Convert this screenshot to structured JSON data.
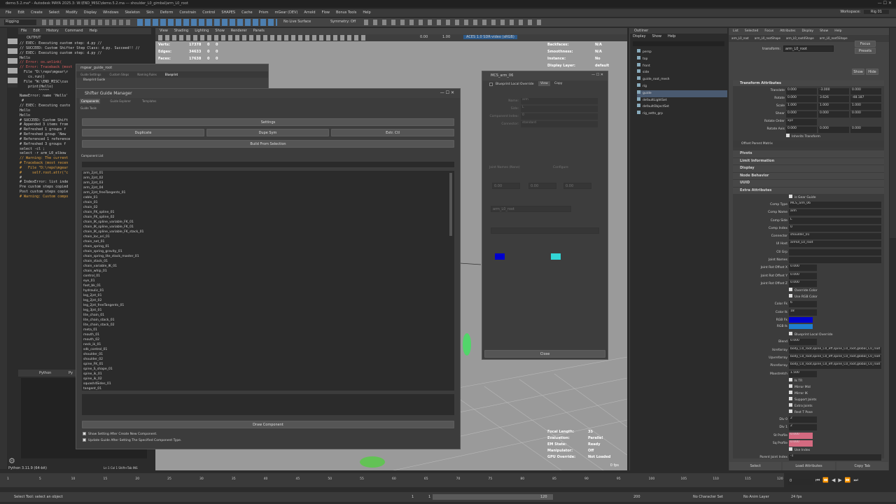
{
  "title_bar": {
    "text": "demo.5.2.ma* - Autodesk MAYA 2025.3: W:\\END_MISC\\demo.5.2.ma --- shoulder_L0_gimbal|arm_L0_root"
  },
  "menubar": {
    "items": [
      "File",
      "Edit",
      "Create",
      "Select",
      "Modify",
      "Display",
      "Windows",
      "Skeleton",
      "Skin",
      "Deform",
      "Constrain",
      "Control",
      "SHAPES",
      "Cache",
      "Prism",
      "mGear (DEV)",
      "Arnold",
      "Flow",
      "Bonus Tools",
      "Help"
    ],
    "workspace_label": "Workspace:",
    "workspace_value": "Rig 01"
  },
  "status_line": {
    "mode": "Rigging",
    "no_live": "No Live Surface",
    "symmetry": "Symmetry: Off"
  },
  "script_editor": {
    "menu": [
      "File",
      "Edit",
      "History",
      "Command",
      "Help"
    ],
    "output_label": "OUTPUT",
    "lines": [
      "// EXEC: Executing custom step: d.py //",
      "// SUCCEED: Custom Shifter Step Class: d.py. Succeed!! //",
      "// EXEC: Executing custom step: d.py //",
      "Hello",
      "// Error: os.unlink(",
      "// Error: Traceback (most",
      "  File \"D:\\repo\\mgear\\r",
      "    cs.run()",
      "  File \"W:\\END_MISC\\cus",
      "    print(Hello)",
      "         ^^^^^",
      "NameError: name 'Hello'",
      " #",
      "// EXEC: Executing custo",
      "Hello",
      "Hello",
      "# SUCCEED: Custom Shift",
      "# Appended 3 items from",
      "# Refreshed 1 groups f",
      "# Refreshed group 'New",
      "# Referenced 1 reference",
      "# Refreshed 3 groups f",
      "select -cl ;",
      "select -r arm_L0_elbow",
      "// Warning: The current",
      "# Traceback (most recen",
      "#   File \"D:\\repo\\mgear",
      "#     self.root.attr(\"c",
      "#",
      "# IndexError: list inde",
      "Pre custom steps copied",
      "Post custom steps copie",
      "# Warning: Custom compo"
    ],
    "tab_python": "Python",
    "tab_py2": "Py",
    "footer": "Python 3.11.9 (64-bit)",
    "line_col": "Ln 1  Col 1  Shift+Tab  INS"
  },
  "viewport": {
    "menu": [
      "View",
      "Shading",
      "Lighting",
      "Show",
      "Renderer",
      "Panels"
    ],
    "hud_left": [
      [
        "Verts:",
        "17378",
        "0",
        "0"
      ],
      [
        "Edges:",
        "34633",
        "0",
        "0"
      ],
      [
        "Faces:",
        "17638",
        "0",
        "0"
      ]
    ],
    "hud_right": [
      [
        "Backfaces:",
        "N/A"
      ],
      [
        "Smoothness:",
        "N/A"
      ],
      [
        "Instance:",
        "No"
      ],
      [
        "Display Layer:",
        "default"
      ]
    ],
    "hud_bottom": [
      [
        "Focal Length:",
        "35"
      ],
      [
        "Evaluation:",
        "Parallel"
      ],
      [
        "EM State:",
        "Ready"
      ],
      [
        "Manipulator:",
        "Off"
      ],
      [
        "GPU Override:",
        "Not Loaded"
      ]
    ],
    "fps": "0 fps",
    "colorspace": "ACES 1.0 SDR-video (sRGB)",
    "val1": "0.00",
    "val2": "1.00"
  },
  "mgear_root": {
    "title": "mgear_guide_root",
    "tabs": [
      "Guide Settings",
      "Custom Steps",
      "Naming Rules",
      "Blueprint"
    ],
    "sub": "Blueprint Guide"
  },
  "shifter": {
    "title": "Shifter Guide Manager",
    "tabs": [
      "Components",
      "Guide Explorer",
      "Templates"
    ],
    "guide_tools": "Guide Tools",
    "settings": "Settings",
    "duplicate": "Duplicate",
    "dupe_sym": "Dupe Sym",
    "extr_ctl": "Extr. Ctl",
    "build": "Build From Selection",
    "component_list": "Component List",
    "components": [
      "arm_2jnt_01",
      "arm_2jnt_02",
      "arm_2jnt_03",
      "arm_2jnt_04",
      "arm_2jnt_freeTangents_01",
      "cable_01",
      "chain_01",
      "chain_02",
      "chain_FK_spline_01",
      "chain_FK_spline_02",
      "chain_IK_spline_variable_FK_01",
      "chain_IK_spline_variable_FK_01",
      "chain_IK_spline_variable_FK_stack_01",
      "chain_loc_ori_01",
      "chain_net_01",
      "chain_spring_01",
      "chain_spring_gravity_01",
      "chain_spring_lite_stack_master_01",
      "chain_stack_01",
      "chain_variable_IK_01",
      "chain_whip_01",
      "control_01",
      "eye_01",
      "foot_bk_01",
      "hydraulic_01",
      "leg_2jnt_01",
      "leg_2jnt_02",
      "leg_2jnt_freeTangents_01",
      "leg_3jnt_01",
      "lite_chain_01",
      "lite_chain_stack_01",
      "lite_chain_stack_02",
      "meta_01",
      "mouth_01",
      "mouth_02",
      "neck_ik_01",
      "sdk_control_01",
      "shoulder_01",
      "shoulder_02",
      "spine_FK_01",
      "spine_S_shape_01",
      "spine_ik_01",
      "spine_ik_02",
      "squash4Sides_01",
      "tangent_01"
    ],
    "draw": "Draw Component",
    "opt1": "Show Setting After Create New Component.",
    "opt2": "Update Guide After Setting The Specified Component Type."
  },
  "mcs_window": {
    "title": "MCS_arm_06",
    "tabs": [
      "View",
      "Copy"
    ],
    "header": "Blueprint Local Override",
    "close": "Close",
    "fields": [
      [
        "Name:",
        "arm"
      ],
      [
        "Side:",
        "L"
      ],
      [
        "Component Index:",
        "0"
      ],
      [
        "Connector:",
        "standard"
      ]
    ],
    "ui_host": "arm_L0_root",
    "configure": "Configure",
    "joint_names": "Joint Names (None)",
    "vals": [
      "0.00",
      "0.00",
      "0.00"
    ],
    "rgb_fk": "#0000cc",
    "rgb_ik": "#33d6d6"
  },
  "outliner": {
    "title": "Outliner",
    "menu": [
      "Display",
      "Show",
      "Help"
    ],
    "items": [
      "persp",
      "top",
      "front",
      "side",
      "guide_root_mesh",
      "rig",
      "guide",
      "defaultLightSet",
      "defaultObjectSet",
      "rig_setts_grp"
    ]
  },
  "attr_editor": {
    "menu": [
      "List",
      "Selected",
      "Focus",
      "Attributes",
      "Display",
      "Show",
      "Help"
    ],
    "tabs": [
      "arm_L0_root",
      "arm_L0_rootShape",
      "arm_L0_root4Shape",
      "arm_L0_root5Shape"
    ],
    "transform_label": "transform:",
    "transform_value": "arm_L0_root",
    "focus": "Focus",
    "presets": "Presets",
    "show": "Show",
    "hide": "Hide",
    "section_transform": "Transform Attributes",
    "translate": [
      "Translate",
      "0.000",
      "-3.000",
      "0.000"
    ],
    "rotate": [
      "Rotate",
      "0.000",
      "3.626",
      "-48.187"
    ],
    "scale": [
      "Scale",
      "1.000",
      "1.000",
      "1.000"
    ],
    "shear": [
      "Shear",
      "0.000",
      "0.000",
      "0.000"
    ],
    "rotate_order": [
      "Rotate Order",
      "xyz"
    ],
    "rotate_axis": [
      "Rotate Axis",
      "0.000",
      "0.000",
      "0.000"
    ],
    "inherits": "Inherits Transform",
    "offset_parent": "Offset Parent Matrix",
    "sections": [
      "Pivots",
      "Limit Information",
      "Display",
      "Node Behavior",
      "UUID",
      "Extra Attributes"
    ],
    "extra": [
      [
        "",
        "is Gear Guide"
      ],
      [
        "Comp Type",
        "MCS_arm_06"
      ],
      [
        "Comp Name",
        "arm"
      ],
      [
        "Comp Side",
        "L"
      ],
      [
        "Comp Index",
        "0"
      ],
      [
        "Connector",
        "shoulder_01"
      ],
      [
        "UI Host",
        "armUI_L0_root"
      ],
      [
        "Ctl Grp",
        ""
      ],
      [
        "Joint Names",
        ""
      ],
      [
        "Joint Rot Offset X",
        "0.000"
      ],
      [
        "Joint Rot Offset Y",
        "0.000"
      ],
      [
        "Joint Rot Offset Z",
        "0.000"
      ]
    ],
    "override_color": "Override Color",
    "use_rgb": "Use RGB Color",
    "color_fk": [
      "Color Fk",
      "6"
    ],
    "color_ik": [
      "Color Ik",
      "18"
    ],
    "rgb_fk": "RGB Fk",
    "rgb_ik": "RGB Ik",
    "bp_override": "Blueprint Local Override",
    "blend": [
      "Blend",
      "0.000"
    ],
    "arrays": [
      [
        "Ikrefarray",
        "body_C0_root,spine_C0_eff,spine_C0_root,global_C0_root"
      ],
      [
        "Upvrefarray",
        "body_C0_root,spine_C0_eff,spine_C0_root,global_C0_root"
      ],
      [
        "Pinrefarray",
        "body_C0_root,spine_C0_eff,spine_C0_root,global_C0_root"
      ]
    ],
    "max_stretch": [
      "Maxstretch",
      "1.500"
    ],
    "checks": [
      "Ik TR",
      "Mirror Mid",
      "Mirror IK",
      "Support Joints",
      "Extra Joints",
      "Rest T Pose"
    ],
    "div0": [
      "Div 0",
      "2"
    ],
    "div1": [
      "Div 1",
      "2"
    ],
    "st_profile": [
      "St Profile",
      "0.000"
    ],
    "sq_profile": [
      "Sq Profile",
      "0.000"
    ],
    "use_index": "Use Index",
    "parent_joint": [
      "Parent Joint Index",
      "-1"
    ],
    "footer": [
      "Select",
      "Load Attributes",
      "Copy Tab"
    ]
  },
  "timeline": {
    "ticks": [
      "1",
      "5",
      "10",
      "15",
      "20",
      "25",
      "30",
      "35",
      "40",
      "45",
      "50",
      "55",
      "60",
      "65",
      "70",
      "75",
      "80",
      "85",
      "90",
      "95",
      "100",
      "105",
      "110",
      "115",
      "120"
    ],
    "current": "0"
  },
  "range": {
    "start": "1",
    "start2": "1",
    "end": "120",
    "end2": "200",
    "char_set": "No Character Set",
    "anim_layer": "No Anim Layer",
    "fps": "24 fps"
  },
  "help_line": "Select Tool: select an object"
}
